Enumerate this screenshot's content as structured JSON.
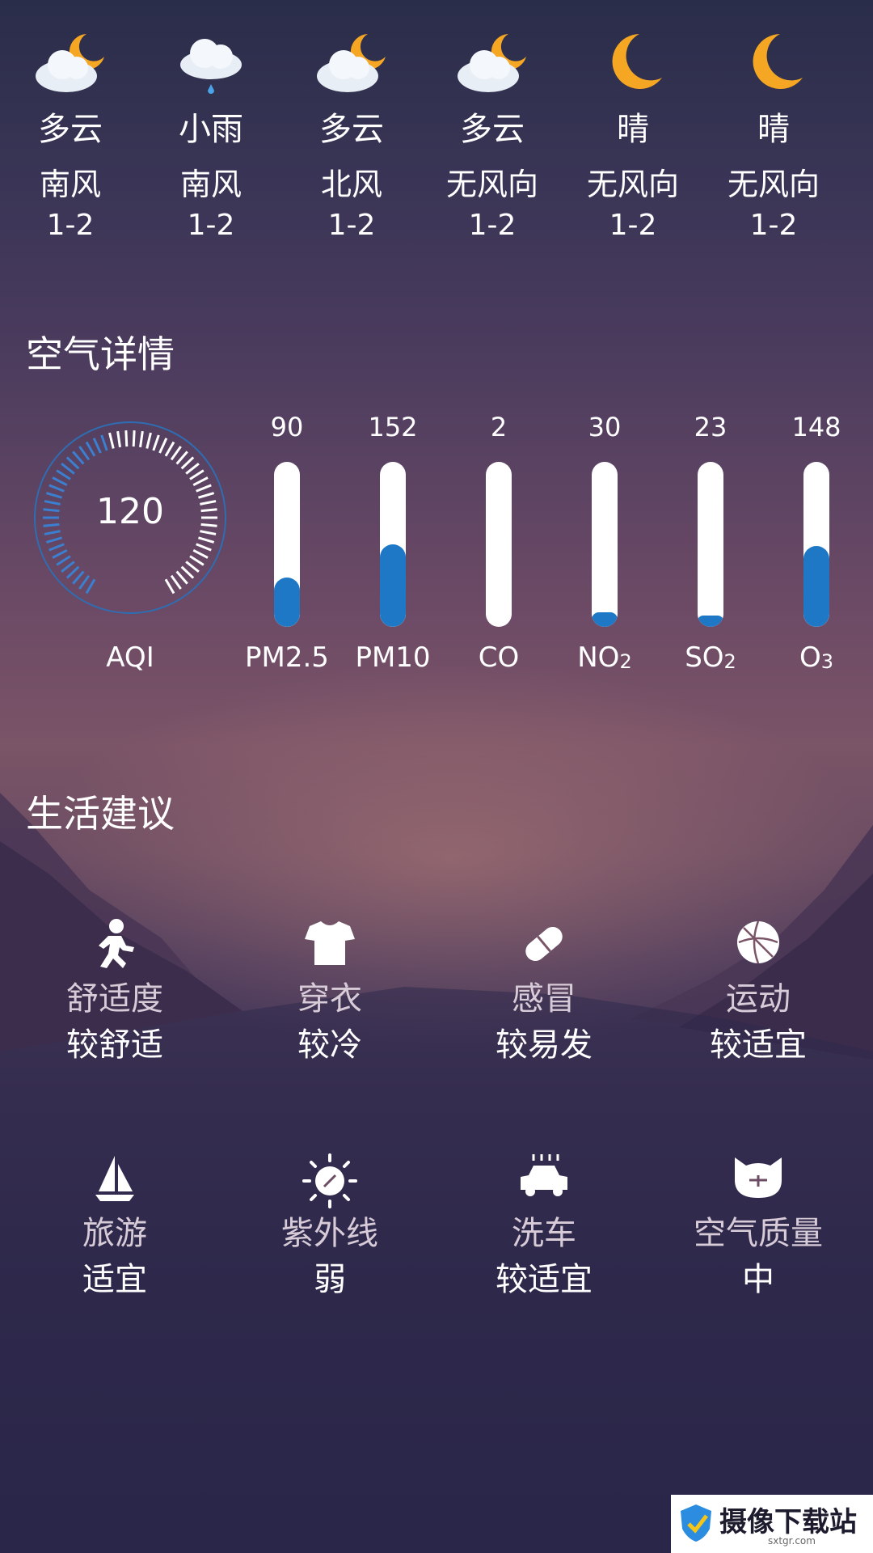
{
  "forecast": [
    {
      "weather": "多云",
      "icon": "cloud-moon-icon",
      "wind_dir": "南风",
      "wind_power": "1-2"
    },
    {
      "weather": "小雨",
      "icon": "light-rain-icon",
      "wind_dir": "南风",
      "wind_power": "1-2"
    },
    {
      "weather": "多云",
      "icon": "cloud-moon-icon",
      "wind_dir": "北风",
      "wind_power": "1-2"
    },
    {
      "weather": "多云",
      "icon": "cloud-moon-icon",
      "wind_dir": "无风向",
      "wind_power": "1-2"
    },
    {
      "weather": "晴",
      "icon": "moon-icon",
      "wind_dir": "无风向",
      "wind_power": "1-2"
    },
    {
      "weather": "晴",
      "icon": "moon-icon",
      "wind_dir": "无风向",
      "wind_power": "1-2"
    }
  ],
  "air": {
    "title": "空气详情",
    "aqi_value": "120",
    "aqi_label": "AQI",
    "aqi_level_fraction": 0.45,
    "pollutants": [
      {
        "value": "90",
        "name": "PM2.5",
        "sub": "",
        "fill": 0.3
      },
      {
        "value": "152",
        "name": "PM10",
        "sub": "",
        "fill": 0.5
      },
      {
        "value": "2",
        "name": "CO",
        "sub": "",
        "fill": 0.0
      },
      {
        "value": "30",
        "name": "NO",
        "sub": "2",
        "fill": 0.09
      },
      {
        "value": "23",
        "name": "SO",
        "sub": "2",
        "fill": 0.07
      },
      {
        "value": "148",
        "name": "O",
        "sub": "3",
        "fill": 0.49
      }
    ]
  },
  "life": {
    "title": "生活建议",
    "items": [
      {
        "label": "舒适度",
        "value": "较舒适",
        "icon": "runner-icon"
      },
      {
        "label": "穿衣",
        "value": "较冷",
        "icon": "shirt-icon"
      },
      {
        "label": "感冒",
        "value": "较易发",
        "icon": "pill-icon"
      },
      {
        "label": "运动",
        "value": "较适宜",
        "icon": "basketball-icon"
      },
      {
        "label": "旅游",
        "value": "适宜",
        "icon": "sailboat-icon"
      },
      {
        "label": "紫外线",
        "value": "弱",
        "icon": "sun-icon"
      },
      {
        "label": "洗车",
        "value": "较适宜",
        "icon": "car-wash-icon"
      },
      {
        "label": "空气质量",
        "value": "中",
        "icon": "mask-cat-icon"
      }
    ]
  },
  "watermark": {
    "text": "摄像下载站",
    "sub": "sxtgr.com"
  },
  "colors": {
    "bar_fill": "#1e78c6",
    "moon": "#f5a623"
  }
}
